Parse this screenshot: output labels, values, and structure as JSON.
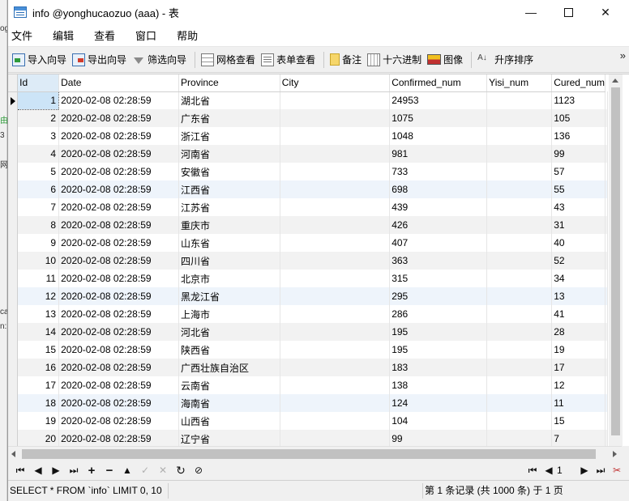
{
  "window": {
    "title": "info @yonghucaozuo (aaa) - 表",
    "minimize": "—",
    "close": "✕"
  },
  "menu": [
    "文件",
    "编辑",
    "查看",
    "窗口",
    "帮助"
  ],
  "toolbar": {
    "import_wizard": "导入向导",
    "export_wizard": "导出向导",
    "filter_wizard": "筛选向导",
    "grid_view": "网格查看",
    "form_view": "表单查看",
    "memo": "备注",
    "hex": "十六进制",
    "image": "图像",
    "sort_asc": "升序排序",
    "more": "»"
  },
  "table": {
    "columns": [
      "Id",
      "Date",
      "Province",
      "City",
      "Confirmed_num",
      "Yisi_num",
      "Cured_num"
    ],
    "rows": [
      [
        "1",
        "2020-02-08 02:28:59",
        "湖北省",
        "",
        "24953",
        "",
        "1123"
      ],
      [
        "2",
        "2020-02-08 02:28:59",
        "广东省",
        "",
        "1075",
        "",
        "105"
      ],
      [
        "3",
        "2020-02-08 02:28:59",
        "浙江省",
        "",
        "1048",
        "",
        "136"
      ],
      [
        "4",
        "2020-02-08 02:28:59",
        "河南省",
        "",
        "981",
        "",
        "99"
      ],
      [
        "5",
        "2020-02-08 02:28:59",
        "安徽省",
        "",
        "733",
        "",
        "57"
      ],
      [
        "6",
        "2020-02-08 02:28:59",
        "江西省",
        "",
        "698",
        "",
        "55"
      ],
      [
        "7",
        "2020-02-08 02:28:59",
        "江苏省",
        "",
        "439",
        "",
        "43"
      ],
      [
        "8",
        "2020-02-08 02:28:59",
        "重庆市",
        "",
        "426",
        "",
        "31"
      ],
      [
        "9",
        "2020-02-08 02:28:59",
        "山东省",
        "",
        "407",
        "",
        "40"
      ],
      [
        "10",
        "2020-02-08 02:28:59",
        "四川省",
        "",
        "363",
        "",
        "52"
      ],
      [
        "11",
        "2020-02-08 02:28:59",
        "北京市",
        "",
        "315",
        "",
        "34"
      ],
      [
        "12",
        "2020-02-08 02:28:59",
        "黑龙江省",
        "",
        "295",
        "",
        "13"
      ],
      [
        "13",
        "2020-02-08 02:28:59",
        "上海市",
        "",
        "286",
        "",
        "41"
      ],
      [
        "14",
        "2020-02-08 02:28:59",
        "河北省",
        "",
        "195",
        "",
        "28"
      ],
      [
        "15",
        "2020-02-08 02:28:59",
        "陕西省",
        "",
        "195",
        "",
        "19"
      ],
      [
        "16",
        "2020-02-08 02:28:59",
        "广西壮族自治区",
        "",
        "183",
        "",
        "17"
      ],
      [
        "17",
        "2020-02-08 02:28:59",
        "云南省",
        "",
        "138",
        "",
        "12"
      ],
      [
        "18",
        "2020-02-08 02:28:59",
        "海南省",
        "",
        "124",
        "",
        "11"
      ],
      [
        "19",
        "2020-02-08 02:28:59",
        "山西省",
        "",
        "104",
        "",
        "15"
      ],
      [
        "20",
        "2020-02-08 02:28:59",
        "辽宁省",
        "",
        "99",
        "",
        "7"
      ]
    ]
  },
  "navigation": {
    "page": "1"
  },
  "status": {
    "sql": "SELECT * FROM `info` LIMIT 0, 10",
    "record_info": "第 1 条记录 (共 1000 条) 于 1 页"
  }
}
